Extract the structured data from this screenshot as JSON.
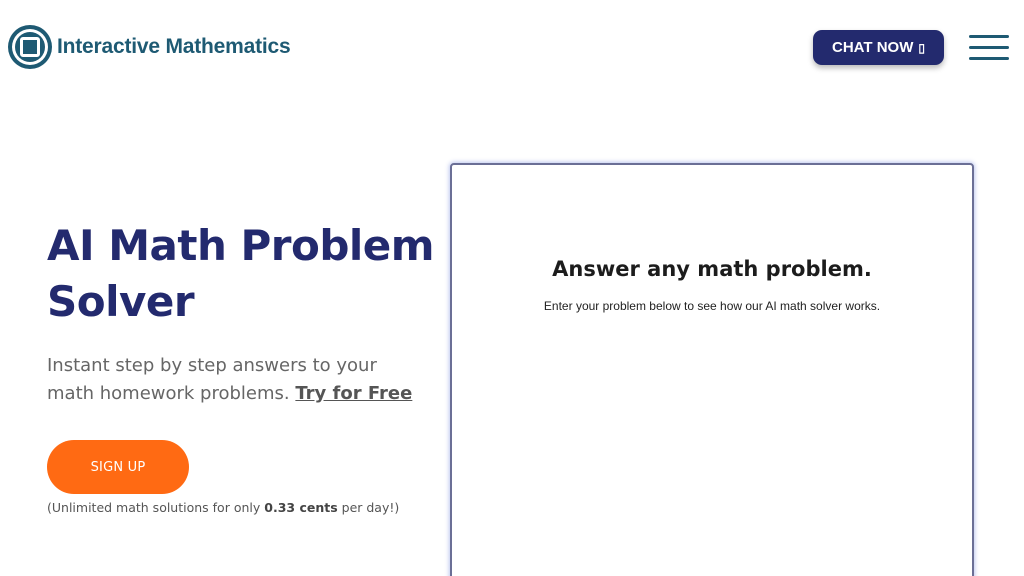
{
  "header": {
    "brand": "Interactive Mathematics",
    "chat_label": "CHAT NOW",
    "chat_glyph": "▯"
  },
  "hero": {
    "title": "AI Math Problem Solver",
    "subtitle": "Instant step by step answers to your math homework problems.",
    "try_link": "Try for Free",
    "signup_label": "SIGN UP",
    "note_prefix": "(Unlimited math solutions for only ",
    "note_bold": "0.33 cents",
    "note_suffix": " per day!)"
  },
  "solver": {
    "title": "Answer any math problem.",
    "description": "Enter your problem below to see how our AI math solver works."
  },
  "colors": {
    "brand_teal": "#1e5a73",
    "navy": "#232a6e",
    "orange": "#ff6a13"
  },
  "icons": {
    "logo": "logo-icon",
    "menu": "menu-icon"
  }
}
